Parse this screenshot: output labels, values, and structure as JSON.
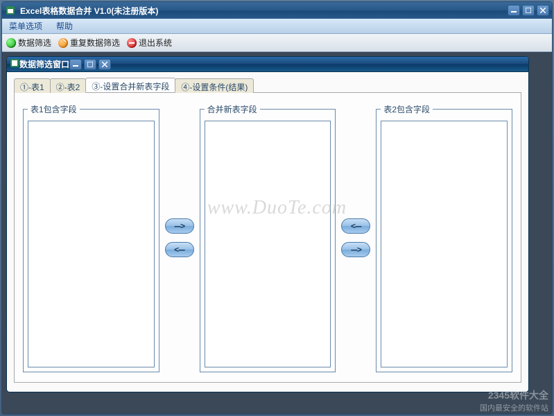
{
  "window": {
    "title": "Excel表格数据合并  V1.0(未注册版本)",
    "min_tip": "最小化",
    "max_tip": "最大化",
    "close_tip": "关闭"
  },
  "menu": {
    "options": "菜单选项",
    "help": "帮助"
  },
  "toolbar": {
    "filter": "数据筛选",
    "refilter": "重复数据筛选",
    "exit": "退出系统"
  },
  "child": {
    "title": "数据筛选窗口"
  },
  "tabs": [
    {
      "label": "①-表1"
    },
    {
      "label": "②-表2"
    },
    {
      "label": "③-设置合并新表字段"
    },
    {
      "label": "④-设置条件(结果)"
    }
  ],
  "groups": {
    "left": "表1包含字段",
    "center": "合并新表字段",
    "right": "表2包含字段"
  },
  "buttons": {
    "move_right": "--->",
    "move_left_from_center": "<---",
    "move_left": "<---",
    "move_right_from_right": "--->"
  },
  "watermark": {
    "center": "www.DuoTe.com",
    "footer_logo": "2345软件大全",
    "footer_text": "国内最安全的软件站"
  }
}
